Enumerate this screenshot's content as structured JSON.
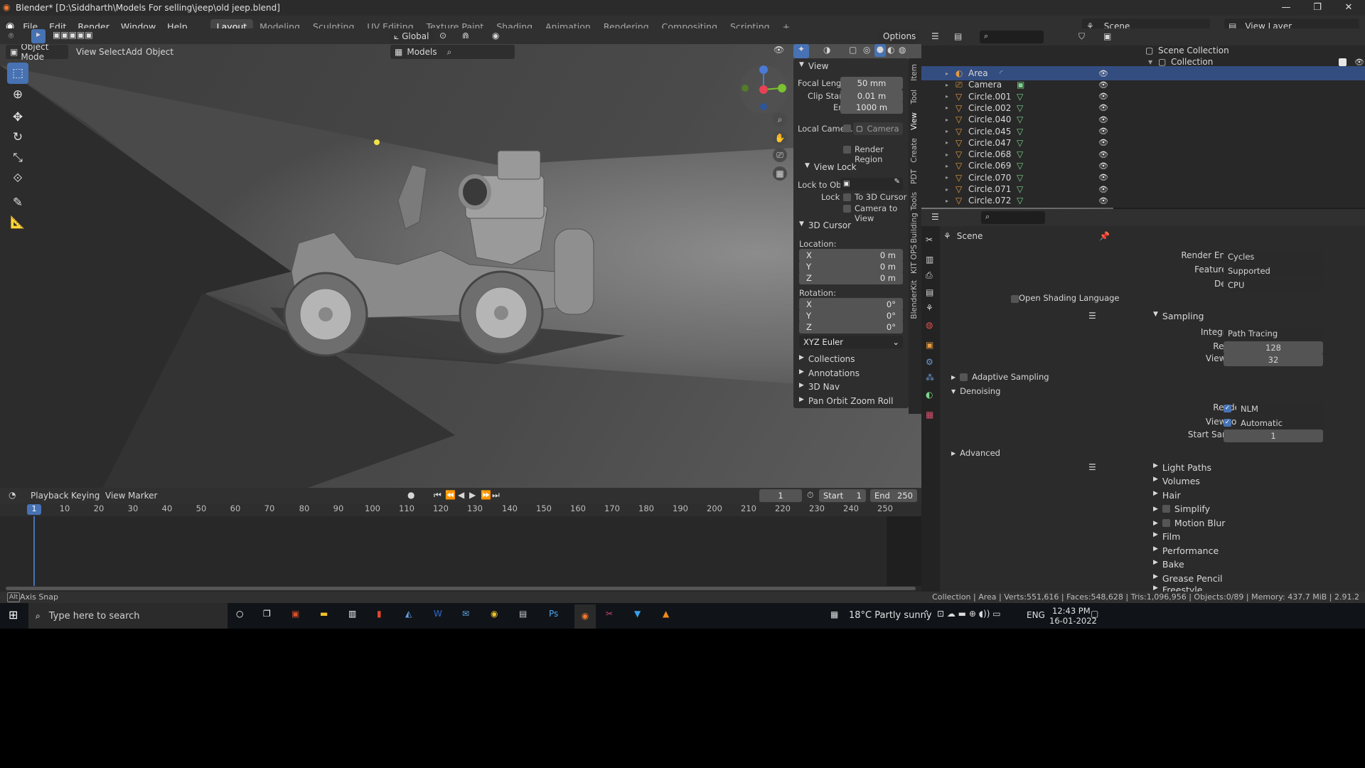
{
  "window": {
    "title": "Blender* [D:\\Siddharth\\Models For selling\\jeep\\old jeep.blend]",
    "controls": [
      "—",
      "❐",
      "✕"
    ]
  },
  "menu": [
    "File",
    "Edit",
    "Render",
    "Window",
    "Help"
  ],
  "workspaces": [
    "Layout",
    "Modeling",
    "Sculpting",
    "UV Editing",
    "Texture Paint",
    "Shading",
    "Animation",
    "Rendering",
    "Compositing",
    "Scripting",
    "+"
  ],
  "scene_selector": {
    "scene": "Scene",
    "view_layer": "View Layer"
  },
  "header": {
    "orientation": "Global",
    "options": "Options",
    "mode": "Object Mode",
    "view_menu": [
      "View",
      "Select",
      "Add",
      "Object"
    ],
    "collection_filter": "Models"
  },
  "npanel": {
    "tabs": [
      "Item",
      "Tool",
      "View",
      "Create",
      "PDT",
      "Building Tools",
      "KIT OPS",
      "BlenderKit"
    ],
    "view_section": {
      "title": "View",
      "focal_length_label": "Focal Length",
      "focal_length": "50 mm",
      "clip_start_label": "Clip Start",
      "clip_start": "0.01 m",
      "end_label": "End",
      "end": "1000 m",
      "local_camera_label": "Local Came...",
      "local_camera": "Camera",
      "render_region": "Render Region"
    },
    "view_lock": {
      "title": "View Lock",
      "lock_to_obj_label": "Lock to Obj...",
      "lock_label": "Lock",
      "to_3d_cursor": "To 3D Cursor",
      "camera_to_view": "Camera to View"
    },
    "cursor": {
      "title": "3D Cursor",
      "location_label": "Location:",
      "x_label": "X",
      "x": "0 m",
      "y_label": "Y",
      "y": "0 m",
      "z_label": "Z",
      "z": "0 m",
      "rotation_label": "Rotation:",
      "rx": "0°",
      "ry": "0°",
      "rz": "0°",
      "mode": "XYZ Euler"
    },
    "collapsed": [
      "Collections",
      "Annotations",
      "3D Nav",
      "Pan Orbit Zoom Roll"
    ]
  },
  "outliner": {
    "scene_collection": "Scene Collection",
    "collection": "Collection",
    "items": [
      "Area",
      "Camera",
      "Circle.001",
      "Circle.002",
      "Circle.040",
      "Circle.045",
      "Circle.047",
      "Circle.068",
      "Circle.069",
      "Circle.070",
      "Circle.071",
      "Circle.072"
    ]
  },
  "properties": {
    "context": "Scene",
    "render_engine_label": "Render Engine",
    "render_engine": "Cycles",
    "feature_set_label": "Feature Set",
    "feature_set": "Supported",
    "device_label": "Device",
    "device": "CPU",
    "osl": "Open Shading Language",
    "sampling": "Sampling",
    "integrator_label": "Integrator",
    "integrator": "Path Tracing",
    "render_label": "Render",
    "render_samples": "128",
    "viewport_label": "Viewport",
    "viewport_samples": "32",
    "adaptive": "Adaptive Sampling",
    "denoising": "Denoising",
    "den_render_label": "Render",
    "den_render": "NLM",
    "den_viewport_label": "Viewport",
    "den_viewport": "Automatic",
    "start_sample_label": "Start Sample",
    "start_sample": "1",
    "advanced": "Advanced",
    "sections": [
      "Light Paths",
      "Volumes",
      "Hair",
      "Simplify",
      "Motion Blur",
      "Film",
      "Performance",
      "Bake",
      "Grease Pencil",
      "Freestyle"
    ]
  },
  "timeline": {
    "menus": [
      "Playback",
      "Keying",
      "View",
      "Marker"
    ],
    "current_frame": "1",
    "start_label": "Start",
    "start": "1",
    "end_label": "End",
    "end": "250",
    "ruler": [
      "10",
      "20",
      "30",
      "40",
      "50",
      "60",
      "70",
      "80",
      "90",
      "100",
      "110",
      "120",
      "130",
      "140",
      "150",
      "160",
      "170",
      "180",
      "190",
      "200",
      "210",
      "220",
      "230",
      "240",
      "250"
    ],
    "playhead": "1"
  },
  "statusbar": {
    "left": "Axis Snap",
    "right": "Collection | Area | Verts:551,616 | Faces:548,628 | Tris:1,096,956 | Objects:0/89 | Memory: 437.7 MiB | 2.91.2"
  },
  "taskbar": {
    "search_placeholder": "Type here to search",
    "weather": "18°C  Partly sunny",
    "lang": "ENG",
    "time": "12:43 PM",
    "date": "16-01-2022"
  },
  "colors": {
    "accent": "#4772b3",
    "selected_row": "#334d80",
    "orange": "#e39a3f"
  }
}
